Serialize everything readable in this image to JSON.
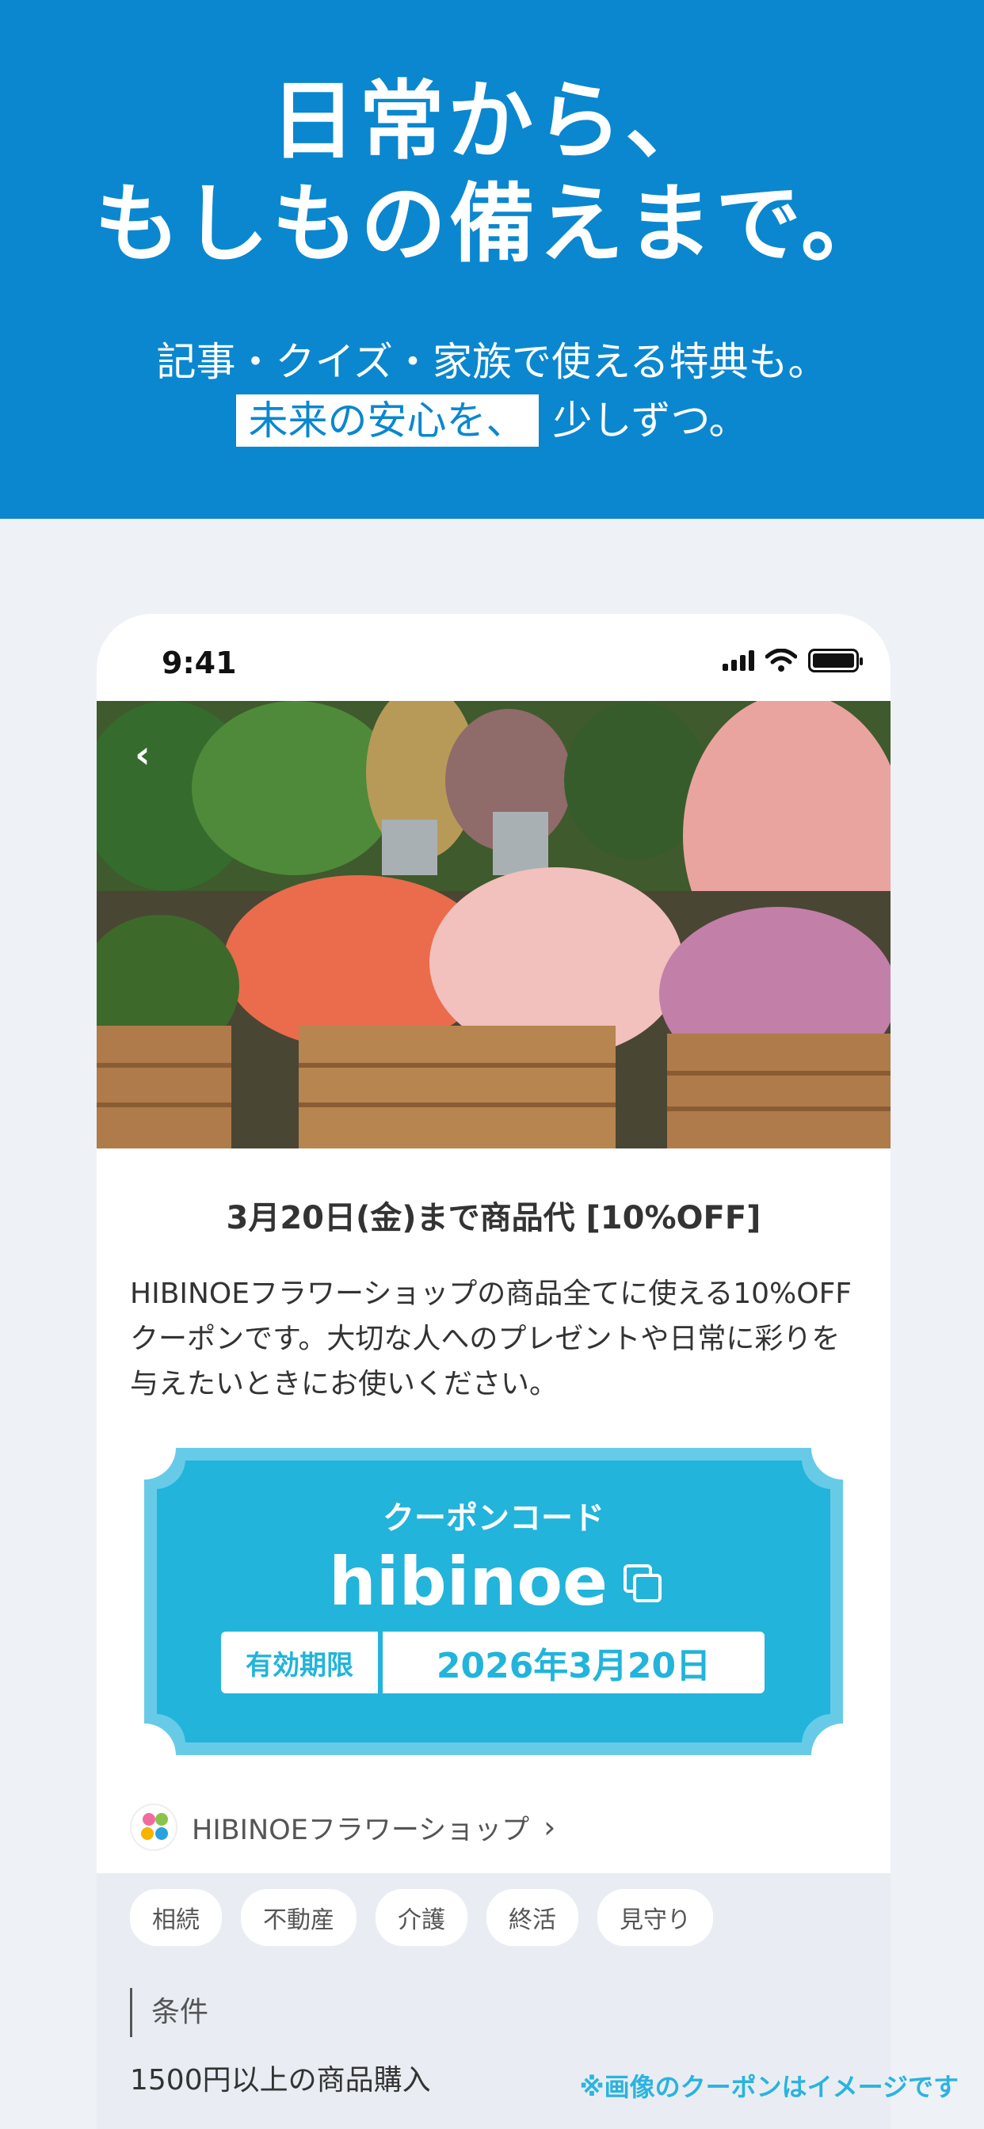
{
  "hero": {
    "title_line1": "日常から、",
    "title_line2": "もしもの備えまで。",
    "sub_line1": "記事・クイズ・家族で使える特典も。",
    "sub_highlight": "未来の安心を、",
    "sub_rest": "少しずつ。"
  },
  "status_bar": {
    "time": "9:41"
  },
  "offer": {
    "title": "3月20日(金)まで商品代 [10%OFF]",
    "description": "HIBINOEフラワーショップの商品全てに使える10%OFFクーポンです。大切な人へのプレゼントや日常に彩りを与えたいときにお使いください。"
  },
  "coupon": {
    "label": "クーポンコード",
    "code": "hibinoe",
    "expiry_label": "有効期限",
    "expiry_value": "2026年3月20日"
  },
  "shop": {
    "name": "HIBINOEフラワーショップ"
  },
  "tags": [
    "相続",
    "不動産",
    "介護",
    "終活",
    "見守り"
  ],
  "conditions": {
    "title": "条件",
    "value": "1500円以上の商品購入"
  },
  "note": "※画像のクーポンはイメージです",
  "colors": {
    "hero_bg": "#0a87cf",
    "coupon": "#22b4db",
    "coupon_border": "#67cbe8"
  }
}
